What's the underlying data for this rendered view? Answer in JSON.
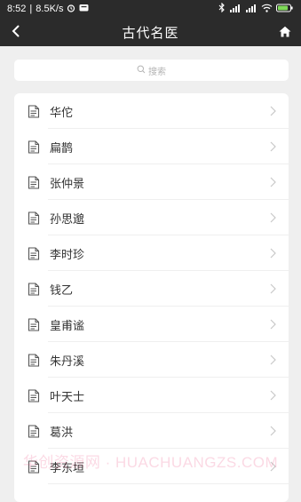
{
  "statusbar": {
    "time": "8:52",
    "speed": "8.5K/s",
    "icons": [
      "alarm-icon",
      "message-icon",
      "bluetooth-icon",
      "signal-icon",
      "wifi-icon",
      "battery-icon"
    ]
  },
  "navbar": {
    "title": "古代名医",
    "back_icon": "chevron-left-icon",
    "home_icon": "home-icon"
  },
  "search": {
    "placeholder": "搜索",
    "icon": "search-icon"
  },
  "list": {
    "items": [
      {
        "label": "华佗"
      },
      {
        "label": "扁鹊"
      },
      {
        "label": "张仲景"
      },
      {
        "label": "孙思邈"
      },
      {
        "label": "李时珍"
      },
      {
        "label": "钱乙"
      },
      {
        "label": "皇甫谧"
      },
      {
        "label": "朱丹溪"
      },
      {
        "label": "叶天士"
      },
      {
        "label": "葛洪"
      },
      {
        "label": "李东垣"
      }
    ],
    "item_icon": "document-icon",
    "trailing_icon": "chevron-right-icon"
  },
  "watermark": "华创资源网 · HUACHUANGZS.COM",
  "colors": {
    "bar": "#2b2b2b",
    "page_bg": "#efefef",
    "card_bg": "#ffffff",
    "text": "#333333",
    "muted": "#b4b4b4"
  }
}
